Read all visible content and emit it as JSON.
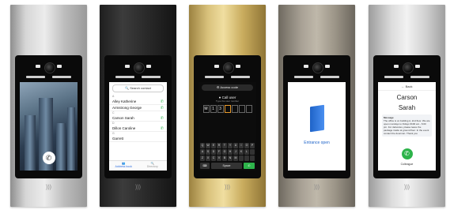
{
  "panel1": {
    "icons": [
      "phone-icon"
    ]
  },
  "panel2": {
    "search_label": "Search contact",
    "groups": [
      {
        "letter": "A",
        "contacts": [
          "Alley Katherine",
          "Armstrong George"
        ]
      },
      {
        "letter": "C",
        "contacts": [
          "Carson Sarah"
        ]
      },
      {
        "letter": "D",
        "contacts": [
          "Dillon Caroline"
        ]
      },
      {
        "letter": "G",
        "contacts": [
          "Garrett"
        ]
      }
    ],
    "tabs": [
      "Address book",
      "Directory"
    ]
  },
  "panel3": {
    "access_label": "Access code",
    "call_label": "Call user",
    "call_sub": "Type the user number",
    "digits": [
      "M",
      "1",
      "3",
      "",
      "",
      "",
      ""
    ],
    "keys": [
      "Q",
      "W",
      "E",
      "R",
      "T",
      "Y",
      "U",
      "I",
      "O",
      "P",
      "A",
      "S",
      "D",
      "F",
      "G",
      "H",
      "J",
      "K",
      "L",
      "",
      "Z",
      "X",
      "C",
      "V",
      "B",
      "N",
      "M",
      "",
      "",
      ""
    ],
    "space_label": "Space"
  },
  "panel4": {
    "status": "Entrance open"
  },
  "panel5": {
    "back_label": "Back",
    "first": "Carson",
    "last": "Sarah",
    "message_title": "Message",
    "message_body": "The office is on building A, 2nd floor. We are open mondays to fridays 9h00 am - 6:00 pm. For deliveries, please leave the package inside at ground floor. In the event contact the doorman. Thank you",
    "call_label": "Colleague"
  },
  "colors": {
    "accent_green": "#2db34a",
    "accent_blue": "#1e63c8",
    "digit_highlight": "#e89a2c"
  }
}
